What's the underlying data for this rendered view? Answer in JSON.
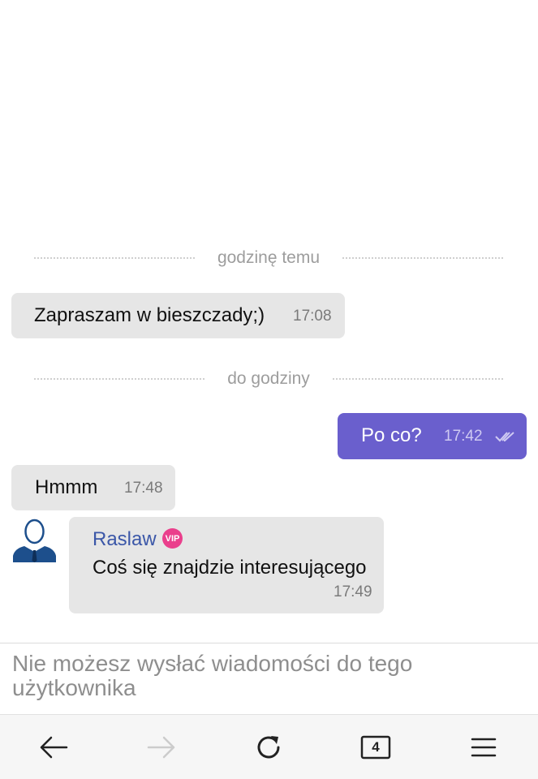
{
  "conversation": {
    "separators": [
      {
        "label": "godzinę temu"
      },
      {
        "label": "do godziny"
      }
    ],
    "messages": [
      {
        "text": "Zapraszam w bieszczady;)",
        "time": "17:08",
        "direction": "incoming"
      },
      {
        "text": "Po co?",
        "time": "17:42",
        "direction": "outgoing",
        "status": "read"
      },
      {
        "text": "Hmmm",
        "time": "17:48",
        "direction": "incoming"
      },
      {
        "sender": "Raslaw",
        "badge": "VIP",
        "text": "Coś się znajdzie interesującego",
        "time": "17:49",
        "direction": "incoming"
      }
    ]
  },
  "composer": {
    "notice": "Nie możesz wysłać wiadomości do tego użytkownika"
  },
  "browser_nav": {
    "tab_count": "4",
    "icons": [
      "back-arrow-icon",
      "forward-arrow-icon",
      "reload-icon",
      "tabs-icon",
      "menu-icon"
    ]
  },
  "colors": {
    "outgoing_bubble": "#6a5fcd",
    "incoming_bubble": "#e6e6e6",
    "sender_name": "#3b57a8",
    "vip_badge": "#ea3f8c"
  }
}
